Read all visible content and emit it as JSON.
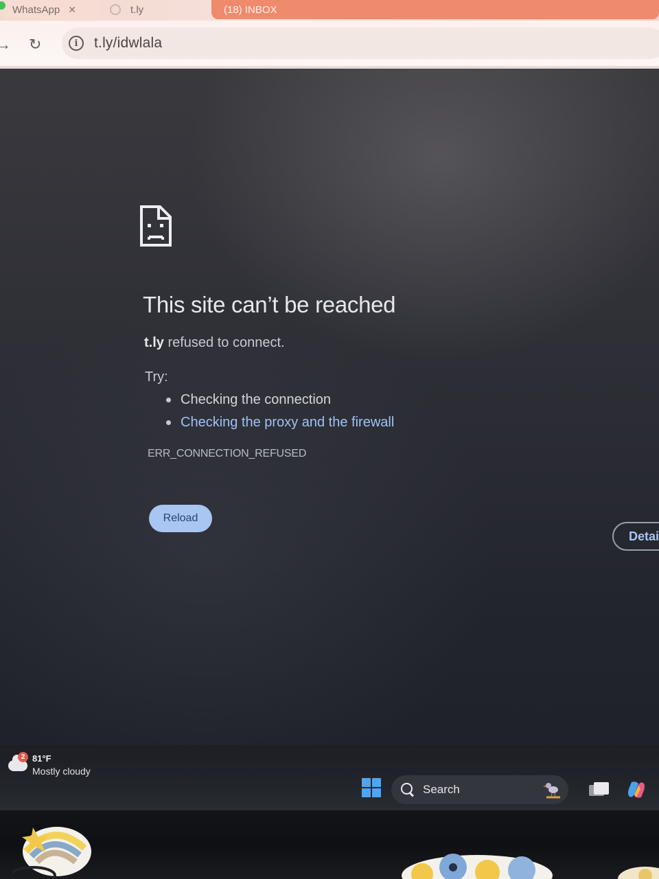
{
  "browser": {
    "tabs": [
      {
        "label": "WhatsApp"
      },
      {
        "label": "t.ly"
      },
      {
        "label": "(18) INBOX"
      }
    ],
    "url": "t.ly/idwlala"
  },
  "error_page": {
    "title": "This site can’t be reached",
    "host": "t.ly",
    "message": " refused to connect.",
    "try_label": "Try:",
    "suggestions": [
      "Checking the connection",
      "Checking the proxy and the firewall"
    ],
    "error_code": "ERR_CONNECTION_REFUSED",
    "reload_label": "Reload",
    "details_label": "Details"
  },
  "taskbar": {
    "weather": {
      "badge": "2",
      "temperature": "81°F",
      "condition": "Mostly cloudy"
    },
    "search_label": "Search"
  },
  "colors": {
    "link": "#9fc2f5",
    "reload_button": "#a9c5f2",
    "windows_accent": "#4da6f2",
    "tab_active": "#f08a6d"
  }
}
